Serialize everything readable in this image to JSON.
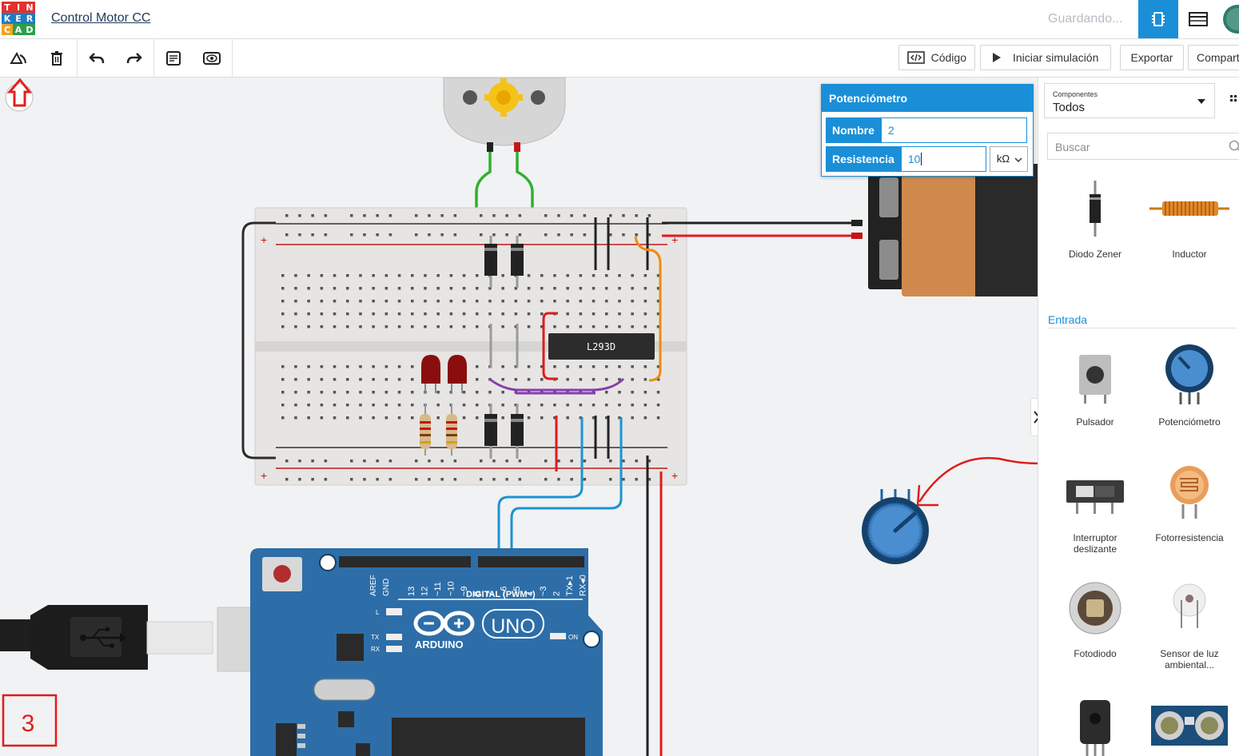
{
  "app": {
    "logo_letters": [
      "T",
      "I",
      "N",
      "K",
      "E",
      "R",
      "C",
      "A",
      "D"
    ],
    "logo_colors": [
      "#e2322d",
      "#e2322d",
      "#e2322d",
      "#1f7cc1",
      "#1f7cc1",
      "#1f7cc1",
      "#f0a326",
      "#2f9e4a",
      "#2f9e4a"
    ],
    "project_title": "Control Motor CC",
    "save_status": "Guardando...",
    "accent": "#1a8fd8"
  },
  "toolbar": {
    "code_label": "Código",
    "simulate_label": "Iniciar simulación",
    "export_label": "Exportar",
    "share_label": "Compart"
  },
  "inspector": {
    "title": "Potenciómetro",
    "name_label": "Nombre",
    "name_value": "2",
    "resistance_label": "Resistencia",
    "resistance_value": "10",
    "unit": "kΩ"
  },
  "sidebar": {
    "components_caption": "Componentes",
    "components_value": "Todos",
    "search_placeholder": "Buscar",
    "section_input": "Entrada",
    "items": [
      {
        "label": "Diodo Zener"
      },
      {
        "label": "Inductor"
      },
      {
        "label": "Pulsador"
      },
      {
        "label": "Potenciómetro"
      },
      {
        "label": "Interruptor deslizante"
      },
      {
        "label": "Fotorresistencia"
      },
      {
        "label": "Fotodiodo"
      },
      {
        "label": "Sensor de luz ambiental..."
      }
    ]
  },
  "canvas": {
    "chip_label": "L293D",
    "arduino_brand": "ARDUINO",
    "arduino_model": "UNO",
    "digital_label": "DIGITAL (PWM~)",
    "on_label": "ON",
    "aref": "AREF",
    "gnd": "GND",
    "tx": "TX",
    "rx": "RX",
    "l": "L",
    "step_number": "3",
    "pin_labels": [
      "13",
      "12",
      "~11",
      "~10",
      "~9",
      "8",
      "7",
      "~6",
      "~5",
      "4",
      "~3",
      "2",
      "TX▸1",
      "RX◂0"
    ]
  }
}
